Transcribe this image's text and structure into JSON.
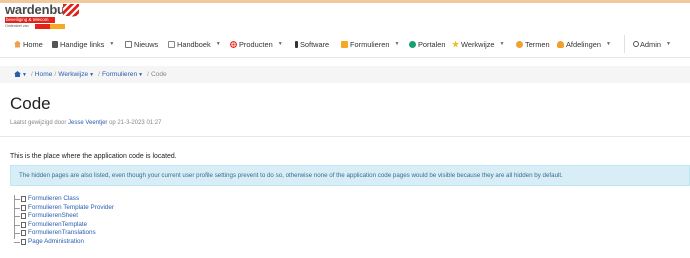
{
  "logo": {
    "name": "wardenburg",
    "tagline": "beveiliging & telecom",
    "sub": "Onderdeel van"
  },
  "nav": {
    "items": [
      {
        "label": "Home",
        "icon": "home-icon",
        "color": "#f0a050"
      },
      {
        "label": "Handige links",
        "icon": "link-icon",
        "color": "#555555"
      },
      {
        "label": "Nieuws",
        "icon": "news-icon",
        "color": "#777777"
      },
      {
        "label": "Handboek",
        "icon": "book-icon",
        "color": "#888888"
      },
      {
        "label": "Producten",
        "icon": "target-icon",
        "color": "#e2231a"
      },
      {
        "label": "Software",
        "icon": "phone-icon",
        "color": "#333333"
      },
      {
        "label": "Formulieren",
        "icon": "forms-icon",
        "color": "#f7a823"
      },
      {
        "label": "Portalen",
        "icon": "globe-icon",
        "color": "#1a9f6e"
      },
      {
        "label": "Werkwijze",
        "icon": "star-icon",
        "color": "#f0c020"
      },
      {
        "label": "Termen",
        "icon": "smiley-icon",
        "color": "#f0a030"
      },
      {
        "label": "Afdelingen",
        "icon": "people-icon",
        "color": "#f0a030"
      },
      {
        "label": "Admin",
        "icon": "admin-icon",
        "color": "#555555"
      }
    ]
  },
  "breadcrumb": {
    "home": "Home",
    "werkwijze": "Werkwijze",
    "formulieren": "Formulieren",
    "current": "Code"
  },
  "page": {
    "title": "Code",
    "meta_prefix": "Laatst gewijzigd door",
    "author": "Jesse Veentjer",
    "meta_suffix": "op 21-3-2023 01:27",
    "intro": "This is the place where the application code is located.",
    "alert": "The hidden pages are also listed, even though your current user profile settings prevent to do so, otherwise none of the application code pages would be visible because they are all hidden by default."
  },
  "tree": [
    "Formulieren Class",
    "Formulieren Template Provider",
    "FormulierenSheet",
    "FormulierenTemplate",
    "FormulierenTranslations",
    "Page Administration"
  ]
}
